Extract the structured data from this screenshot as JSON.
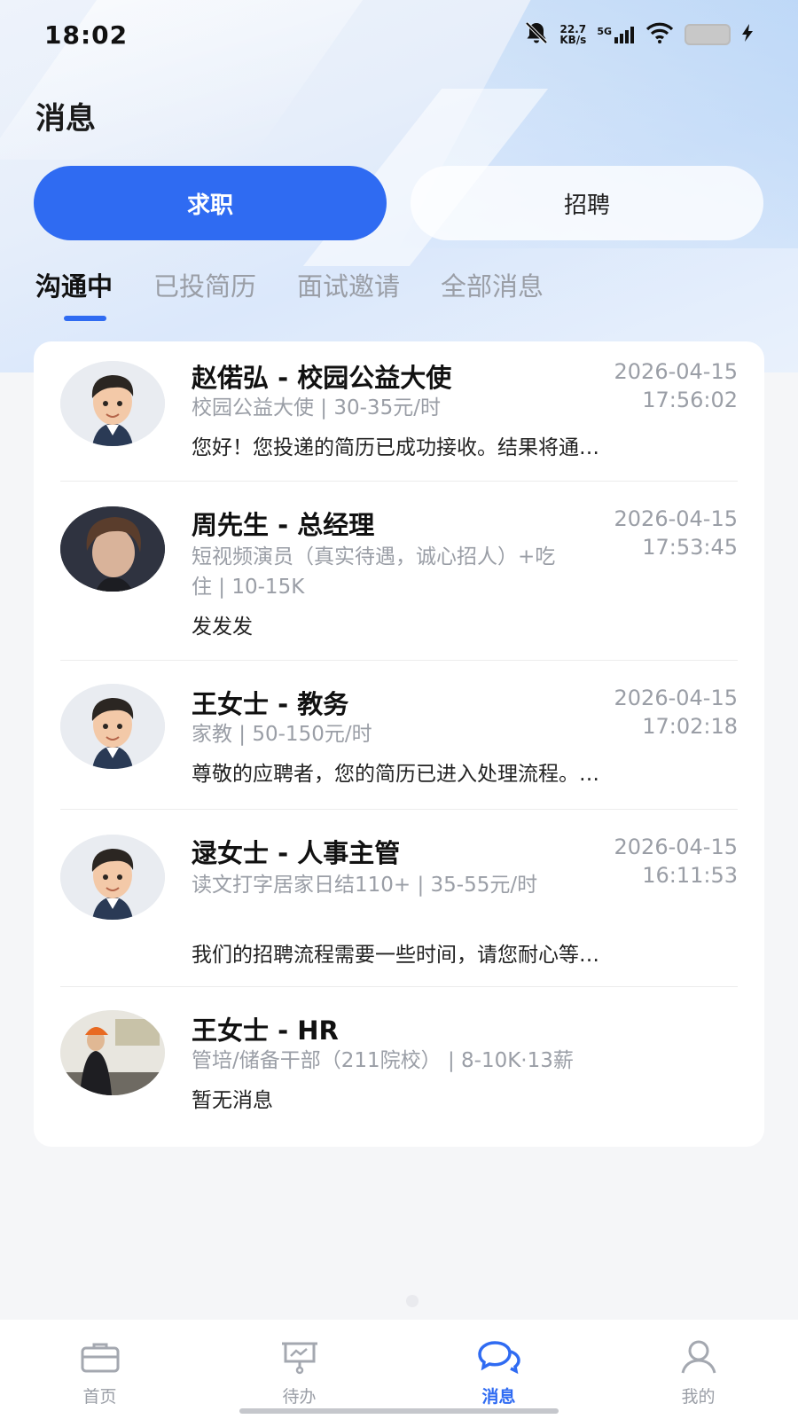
{
  "status_bar": {
    "time": "18:02",
    "speed_value": "22.7",
    "speed_unit": "KB/s",
    "network": "5G"
  },
  "page": {
    "title": "消息"
  },
  "segments": {
    "job_seeking": "求职",
    "recruiting": "招聘",
    "active": "求职"
  },
  "tabs": [
    {
      "label": "沟通中",
      "active": true
    },
    {
      "label": "已投简历",
      "active": false
    },
    {
      "label": "面试邀请",
      "active": false
    },
    {
      "label": "全部消息",
      "active": false
    }
  ],
  "conversations": [
    {
      "title": "赵偌弘 - 校园公益大使",
      "subtitle": "校园公益大使 | 30-35元/时",
      "message": "您好！您投递的简历已成功接收。结果将通…",
      "date": "2026-04-15",
      "time": "17:56:02",
      "avatar": "cartoon-avatar"
    },
    {
      "title": "周先生 - 总经理",
      "subtitle": "短视频演员（真实待遇，诚心招人）+吃住 | 10-15K",
      "message": "发发发",
      "date": "2026-04-15",
      "time": "17:53:45",
      "avatar": "photo-avatar"
    },
    {
      "title": "王女士 - 教务",
      "subtitle": "家教 | 50-150元/时",
      "message": "尊敬的应聘者，您的简历已进入处理流程。…",
      "date": "2026-04-15",
      "time": "17:02:18",
      "avatar": "cartoon-avatar"
    },
    {
      "title": "逯女士 - 人事主管",
      "subtitle": "读文打字居家日结110+ | 35-55元/时",
      "message": "我们的招聘流程需要一些时间，请您耐心等…",
      "date": "2026-04-15",
      "time": "16:11:53",
      "avatar": "cartoon-avatar"
    },
    {
      "title": "王女士 - HR",
      "subtitle": "管培/储备干部（211院校） | 8-10K·13薪",
      "message": "暂无消息",
      "date": "",
      "time": "",
      "avatar": "photo-avatar"
    }
  ],
  "bottom_nav": [
    {
      "label": "首页",
      "icon": "briefcase-icon",
      "active": false
    },
    {
      "label": "待办",
      "icon": "presentation-board-icon",
      "active": false
    },
    {
      "label": "消息",
      "icon": "chat-bubbles-icon",
      "active": true
    },
    {
      "label": "我的",
      "icon": "user-icon",
      "active": false
    }
  ],
  "colors": {
    "accent": "#2f6bf2",
    "muted": "#9a9ea6"
  }
}
